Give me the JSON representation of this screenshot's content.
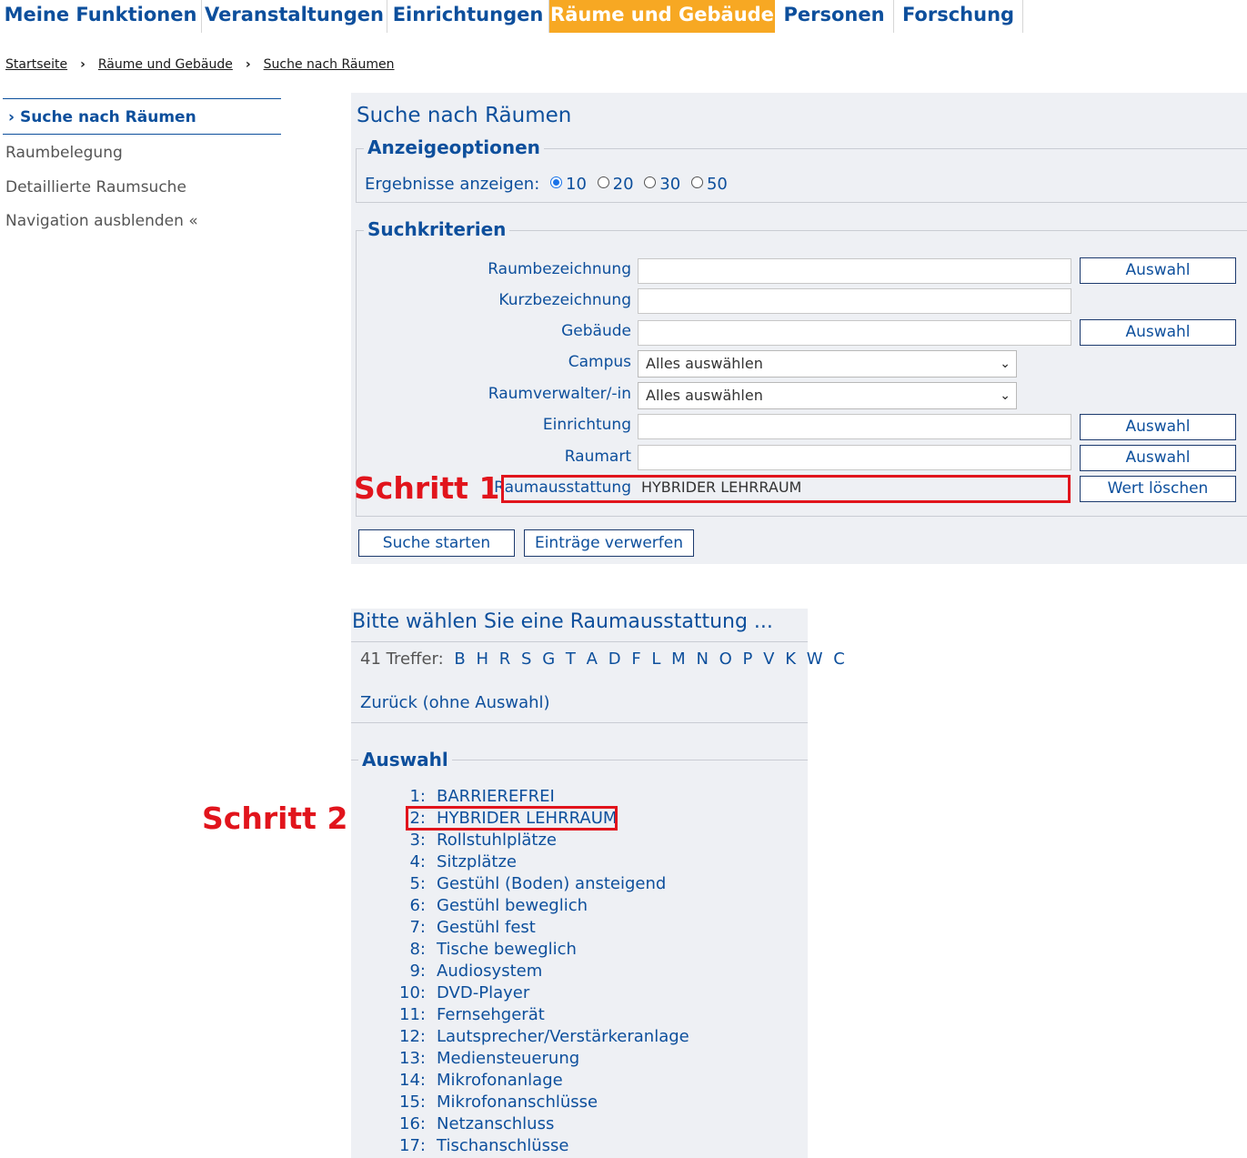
{
  "nav": {
    "tabs": [
      {
        "label": "Meine Funktionen"
      },
      {
        "label": "Veranstaltungen"
      },
      {
        "label": "Einrichtungen"
      },
      {
        "label": "Räume und Gebäude"
      },
      {
        "label": "Personen"
      },
      {
        "label": "Forschung"
      }
    ],
    "active_color": "#f7a823"
  },
  "breadcrumb": [
    "Startseite",
    "Räume und Gebäude",
    "Suche nach Räumen"
  ],
  "sidebar": {
    "active": "Suche nach Räumen",
    "items": [
      "Raumbelegung",
      "Detaillierte Raumsuche",
      "Navigation ausblenden «"
    ]
  },
  "search": {
    "title": "Suche nach Räumen",
    "display_options": {
      "legend": "Anzeigeoptionen",
      "label": "Ergebnisse anzeigen:",
      "options": [
        "10",
        "20",
        "30",
        "50"
      ],
      "selected": "10"
    },
    "criteria": {
      "legend": "Suchkriterien",
      "fields": [
        {
          "label": "Raumbezeichnung",
          "value": "",
          "button": "Auswahl"
        },
        {
          "label": "Kurzbezeichnung",
          "value": ""
        },
        {
          "label": "Gebäude",
          "value": "",
          "button": "Auswahl"
        },
        {
          "label": "Campus",
          "value": "Alles auswählen"
        },
        {
          "label": "Raumverwalter/-in",
          "value": "Alles auswählen"
        },
        {
          "label": "Einrichtung",
          "value": "",
          "button": "Auswahl"
        },
        {
          "label": "Raumart",
          "value": "",
          "button": "Auswahl"
        },
        {
          "label": "Raumausstattung",
          "value": "HYBRIDER LEHRRAUM",
          "button": "Wert löschen"
        }
      ]
    },
    "start_button": "Suche starten",
    "reset_button": "Einträge verwerfen"
  },
  "annotations": {
    "step1": "Schritt 1",
    "step2": "Schritt 2",
    "highlight_color": "#e1141c"
  },
  "selection": {
    "title": "Bitte wählen Sie eine Raumausstattung ...",
    "hits": "41 Treffer:",
    "letters": [
      "B",
      "H",
      "R",
      "S",
      "G",
      "T",
      "A",
      "D",
      "F",
      "L",
      "M",
      "N",
      "O",
      "P",
      "V",
      "K",
      "W",
      "C"
    ],
    "back_link": "Zurück",
    "back_suffix": "(ohne Auswahl)",
    "legend": "Auswahl",
    "items": [
      {
        "num": "1:",
        "label": "BARRIEREFREI"
      },
      {
        "num": "2:",
        "label": "HYBRIDER LEHRRAUM"
      },
      {
        "num": "3:",
        "label": "Rollstuhlplätze"
      },
      {
        "num": "4:",
        "label": "Sitzplätze"
      },
      {
        "num": "5:",
        "label": "Gestühl (Boden) ansteigend"
      },
      {
        "num": "6:",
        "label": "Gestühl beweglich"
      },
      {
        "num": "7:",
        "label": "Gestühl fest"
      },
      {
        "num": "8:",
        "label": "Tische beweglich"
      },
      {
        "num": "9:",
        "label": "Audiosystem"
      },
      {
        "num": "10:",
        "label": "DVD-Player"
      },
      {
        "num": "11:",
        "label": "Fernsehgerät"
      },
      {
        "num": "12:",
        "label": "Lautsprecher/Verstärkeranlage"
      },
      {
        "num": "13:",
        "label": "Mediensteuerung"
      },
      {
        "num": "14:",
        "label": "Mikrofonanlage"
      },
      {
        "num": "15:",
        "label": "Mikrofonanschlüsse"
      },
      {
        "num": "16:",
        "label": "Netzanschluss"
      },
      {
        "num": "17:",
        "label": "Tischanschlüsse"
      }
    ]
  }
}
